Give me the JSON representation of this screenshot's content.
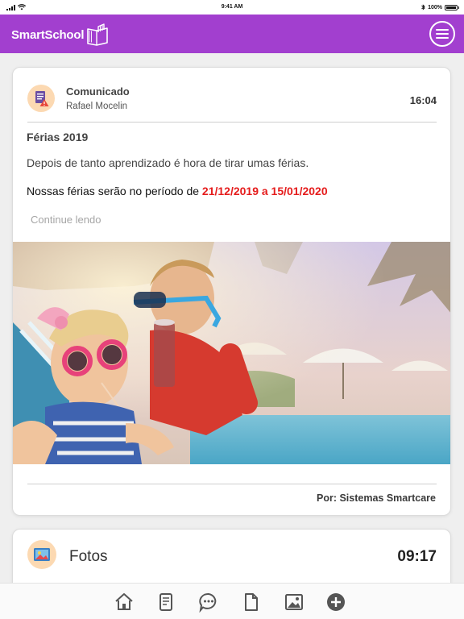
{
  "status_bar": {
    "time": "9:41 AM",
    "battery": "100%",
    "battery_level": 1.0
  },
  "header": {
    "app_name": "SmartSchool",
    "brand_color": "#a23fcf",
    "menu_icon": "hamburger-menu-icon"
  },
  "post": {
    "category": "Comunicado",
    "author": "Rafael Mocelin",
    "time": "16:04",
    "title": "Férias 2019",
    "body": "Depois de tanto aprendizado é hora de tirar umas férias.",
    "dates_prefix": "Nossas férias serão no período de ",
    "dates_highlight": "21/12/2019 a 15/01/2020",
    "highlight_color": "#e51c1c",
    "continue_label": "Continue lendo",
    "photo": "children-at-pool-photo",
    "signature": "Por: Sistemas Smartcare",
    "icon": "document-warning-icon"
  },
  "photos_card": {
    "title": "Fotos",
    "time": "09:17",
    "icon": "picture-icon"
  },
  "tab_bar": {
    "items": [
      {
        "icon": "home-icon"
      },
      {
        "icon": "notes-icon"
      },
      {
        "icon": "chat-icon"
      },
      {
        "icon": "file-icon"
      },
      {
        "icon": "image-icon"
      },
      {
        "icon": "add-icon"
      }
    ]
  }
}
